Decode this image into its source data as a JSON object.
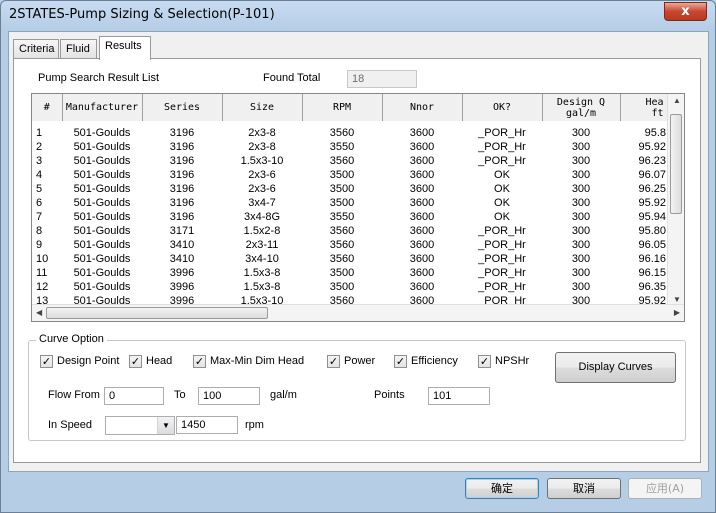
{
  "window": {
    "title": "2STATES-Pump Sizing & Selection(P-101)",
    "close_glyph": "x"
  },
  "tabs": [
    {
      "label": "Criteria"
    },
    {
      "label": "Fluid"
    },
    {
      "label": "Results"
    }
  ],
  "results": {
    "list_label": "Pump Search Result List",
    "found_total_label": "Found Total",
    "found_total_value": "18",
    "columns": [
      "#",
      "Manufacturer",
      "Series",
      "Size",
      "RPM",
      "Nnor",
      "OK?",
      "Design Q\ngal/m",
      "Hea\nft"
    ],
    "rows": [
      [
        "1",
        "501-Goulds",
        "3196",
        "2x3-8",
        "3560",
        "3600",
        "_POR_Hr",
        "300",
        "95.8"
      ],
      [
        "2",
        "501-Goulds",
        "3196",
        "2x3-8",
        "3550",
        "3600",
        "_POR_Hr",
        "300",
        "95.92"
      ],
      [
        "3",
        "501-Goulds",
        "3196",
        "1.5x3-10",
        "3560",
        "3600",
        "_POR_Hr",
        "300",
        "96.23"
      ],
      [
        "4",
        "501-Goulds",
        "3196",
        "2x3-6",
        "3500",
        "3600",
        "OK",
        "300",
        "96.07"
      ],
      [
        "5",
        "501-Goulds",
        "3196",
        "2x3-6",
        "3500",
        "3600",
        "OK",
        "300",
        "96.25"
      ],
      [
        "6",
        "501-Goulds",
        "3196",
        "3x4-7",
        "3500",
        "3600",
        "OK",
        "300",
        "95.92"
      ],
      [
        "7",
        "501-Goulds",
        "3196",
        "3x4-8G",
        "3550",
        "3600",
        "OK",
        "300",
        "95.94"
      ],
      [
        "8",
        "501-Goulds",
        "3171",
        "1.5x2-8",
        "3560",
        "3600",
        "_POR_Hr",
        "300",
        "95.80"
      ],
      [
        "9",
        "501-Goulds",
        "3410",
        "2x3-11",
        "3560",
        "3600",
        "_POR_Hr",
        "300",
        "96.05"
      ],
      [
        "10",
        "501-Goulds",
        "3410",
        "3x4-10",
        "3560",
        "3600",
        "_POR_Hr",
        "300",
        "96.16"
      ],
      [
        "11",
        "501-Goulds",
        "3996",
        "1.5x3-8",
        "3500",
        "3600",
        "_POR_Hr",
        "300",
        "96.15"
      ],
      [
        "12",
        "501-Goulds",
        "3996",
        "1.5x3-8",
        "3500",
        "3600",
        "_POR_Hr",
        "300",
        "96.35"
      ],
      [
        "13",
        "501-Goulds",
        "3996",
        "1.5x3-10",
        "3560",
        "3600",
        "_POR_Hr",
        "300",
        "95.92"
      ]
    ]
  },
  "curve_option": {
    "title": "Curve Option",
    "checkboxes": [
      {
        "label": "Design Point",
        "checked": true
      },
      {
        "label": "Head",
        "checked": true
      },
      {
        "label": "Max-Min Dim Head",
        "checked": true
      },
      {
        "label": "Power",
        "checked": true
      },
      {
        "label": "Efficiency",
        "checked": true
      },
      {
        "label": "NPSHr",
        "checked": true
      }
    ],
    "display_curves_label": "Display Curves",
    "flow_from_label": "Flow From",
    "flow_from_value": "0",
    "to_label": "To",
    "to_value": "100",
    "flow_unit": "gal/m",
    "points_label": "Points",
    "points_value": "101",
    "in_speed_label": "In Speed",
    "in_speed_select": "",
    "speed_value": "1450",
    "speed_unit": "rpm"
  },
  "footer": {
    "ok_label": "确定",
    "cancel_label": "取消",
    "apply_label": "应用(A)"
  },
  "colors": {
    "title_bar": "#c7dcf2",
    "close_button": "#c8462e",
    "panel_bg": "#ffffff",
    "dialog_bg": "#f0f0f0"
  }
}
